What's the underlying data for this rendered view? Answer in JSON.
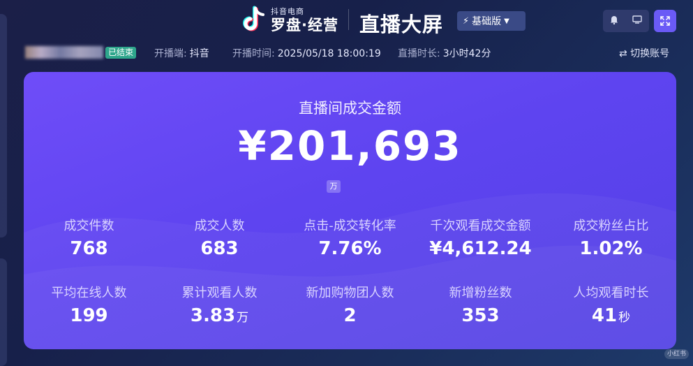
{
  "header": {
    "logo_small": "抖音电商",
    "logo_big": "罗盘·经营",
    "page_title": "直播大屏",
    "version_label": "基础版"
  },
  "info": {
    "status_badge": "已结束",
    "platform_label": "开播端:",
    "platform_value": "抖音",
    "start_time_label": "开播时间:",
    "start_time_value": "2025/05/18 18:00:19",
    "duration_label": "直播时长:",
    "duration_value": "3小时42分",
    "switch_account": "⇄ 切换账号"
  },
  "main": {
    "title": "直播间成交金额",
    "amount": "¥201,693",
    "unit": "万"
  },
  "metrics": [
    {
      "label": "成交件数",
      "value": "768",
      "suffix": ""
    },
    {
      "label": "成交人数",
      "value": "683",
      "suffix": ""
    },
    {
      "label": "点击-成交转化率",
      "value": "7.76%",
      "suffix": ""
    },
    {
      "label": "千次观看成交金额",
      "value": "¥4,612.24",
      "suffix": ""
    },
    {
      "label": "成交粉丝占比",
      "value": "1.02%",
      "suffix": ""
    },
    {
      "label": "平均在线人数",
      "value": "199",
      "suffix": ""
    },
    {
      "label": "累计观看人数",
      "value": "3.83",
      "suffix": "万"
    },
    {
      "label": "新加购物团人数",
      "value": "2",
      "suffix": ""
    },
    {
      "label": "新增粉丝数",
      "value": "353",
      "suffix": ""
    },
    {
      "label": "人均观看时长",
      "value": "41",
      "suffix": "秒"
    }
  ],
  "watermark": "小红书",
  "colors": {
    "accent": "#6a5af6",
    "card_start": "#6f4df8",
    "card_end": "#5240e4",
    "ended_badge": "#2ea68c"
  },
  "icons": [
    "tiktok-logo-icon",
    "bolt-icon",
    "caret-down-icon",
    "bell-icon",
    "monitor-icon",
    "fullscreen-icon",
    "swap-icon"
  ]
}
